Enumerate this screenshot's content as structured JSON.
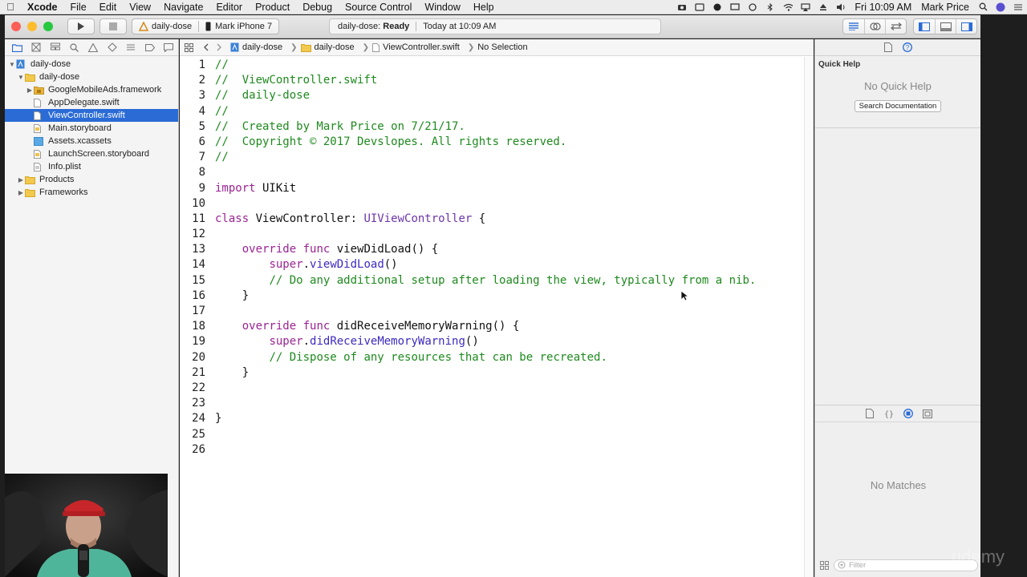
{
  "menubar": {
    "apple_icon": "apple-logo-icon",
    "items": [
      "Xcode",
      "File",
      "Edit",
      "View",
      "Navigate",
      "Editor",
      "Product",
      "Debug",
      "Source Control",
      "Window",
      "Help"
    ],
    "clock": "Fri 10:09 AM",
    "user": "Mark Price"
  },
  "toolbar": {
    "scheme": "daily-dose",
    "device": "Mark iPhone 7",
    "activity_project": "daily-dose:",
    "activity_status": "Ready",
    "activity_time": "Today at 10:09 AM"
  },
  "navigator": {
    "rows": [
      {
        "label": "daily-dose",
        "depth": 0,
        "kind": "project",
        "open": true
      },
      {
        "label": "daily-dose",
        "depth": 1,
        "kind": "folder",
        "open": true
      },
      {
        "label": "GoogleMobileAds.framework",
        "depth": 2,
        "kind": "framework",
        "open": false
      },
      {
        "label": "AppDelegate.swift",
        "depth": 2,
        "kind": "swift"
      },
      {
        "label": "ViewController.swift",
        "depth": 2,
        "kind": "swift",
        "selected": true
      },
      {
        "label": "Main.storyboard",
        "depth": 2,
        "kind": "storyboard"
      },
      {
        "label": "Assets.xcassets",
        "depth": 2,
        "kind": "assets"
      },
      {
        "label": "LaunchScreen.storyboard",
        "depth": 2,
        "kind": "storyboard"
      },
      {
        "label": "Info.plist",
        "depth": 2,
        "kind": "plist"
      },
      {
        "label": "Products",
        "depth": 1,
        "kind": "folder",
        "open": false
      },
      {
        "label": "Frameworks",
        "depth": 1,
        "kind": "folder",
        "open": false
      }
    ]
  },
  "jumpbar": {
    "project": "daily-dose",
    "group": "daily-dose",
    "file": "ViewController.swift",
    "selection": "No Selection"
  },
  "code": [
    {
      "n": "1",
      "t": [
        [
          "c",
          "//"
        ]
      ]
    },
    {
      "n": "2",
      "t": [
        [
          "c",
          "//  ViewController.swift"
        ]
      ]
    },
    {
      "n": "3",
      "t": [
        [
          "c",
          "//  daily-dose"
        ]
      ]
    },
    {
      "n": "4",
      "t": [
        [
          "c",
          "//"
        ]
      ]
    },
    {
      "n": "5",
      "t": [
        [
          "c",
          "//  Created by Mark Price on 7/21/17."
        ]
      ]
    },
    {
      "n": "6",
      "t": [
        [
          "c",
          "//  Copyright © 2017 Devslopes. All rights reserved."
        ]
      ]
    },
    {
      "n": "7",
      "t": [
        [
          "c",
          "//"
        ]
      ]
    },
    {
      "n": "8",
      "t": []
    },
    {
      "n": "9",
      "t": [
        [
          "k",
          "import"
        ],
        [
          "p",
          " UIKit"
        ]
      ]
    },
    {
      "n": "10",
      "t": []
    },
    {
      "n": "11",
      "t": [
        [
          "k",
          "class"
        ],
        [
          "p",
          " ViewController: "
        ],
        [
          "y",
          "UIViewController"
        ],
        [
          "p",
          " {"
        ]
      ]
    },
    {
      "n": "12",
      "t": []
    },
    {
      "n": "13",
      "t": [
        [
          "p",
          "    "
        ],
        [
          "k",
          "override"
        ],
        [
          "p",
          " "
        ],
        [
          "k",
          "func"
        ],
        [
          "p",
          " viewDidLoad() {"
        ]
      ]
    },
    {
      "n": "14",
      "t": [
        [
          "p",
          "        "
        ],
        [
          "k",
          "super"
        ],
        [
          "p",
          "."
        ],
        [
          "f",
          "viewDidLoad"
        ],
        [
          "p",
          "()"
        ]
      ]
    },
    {
      "n": "15",
      "t": [
        [
          "p",
          "        "
        ],
        [
          "c",
          "// Do any additional setup after loading the view, typically from a nib."
        ]
      ]
    },
    {
      "n": "16",
      "t": [
        [
          "p",
          "    }"
        ]
      ]
    },
    {
      "n": "17",
      "t": []
    },
    {
      "n": "18",
      "t": [
        [
          "p",
          "    "
        ],
        [
          "k",
          "override"
        ],
        [
          "p",
          " "
        ],
        [
          "k",
          "func"
        ],
        [
          "p",
          " didReceiveMemoryWarning() {"
        ]
      ]
    },
    {
      "n": "19",
      "t": [
        [
          "p",
          "        "
        ],
        [
          "k",
          "super"
        ],
        [
          "p",
          "."
        ],
        [
          "f",
          "didReceiveMemoryWarning"
        ],
        [
          "p",
          "()"
        ]
      ]
    },
    {
      "n": "20",
      "t": [
        [
          "p",
          "        "
        ],
        [
          "c",
          "// Dispose of any resources that can be recreated."
        ]
      ]
    },
    {
      "n": "21",
      "t": [
        [
          "p",
          "    }"
        ]
      ]
    },
    {
      "n": "22",
      "t": []
    },
    {
      "n": "23",
      "t": []
    },
    {
      "n": "24",
      "t": [
        [
          "p",
          "}"
        ]
      ]
    },
    {
      "n": "25",
      "t": []
    },
    {
      "n": "26",
      "t": []
    }
  ],
  "inspector": {
    "quick_help_title": "Quick Help",
    "no_quick_help": "No Quick Help",
    "search_docs": "Search Documentation",
    "no_matches": "No Matches",
    "filter_placeholder": "Filter"
  },
  "watermark": "udemy",
  "colors": {
    "comment": "#1e8a1e",
    "keyword": "#9b2393",
    "type": "#6c36a9",
    "selection": "#2a6bd6"
  }
}
